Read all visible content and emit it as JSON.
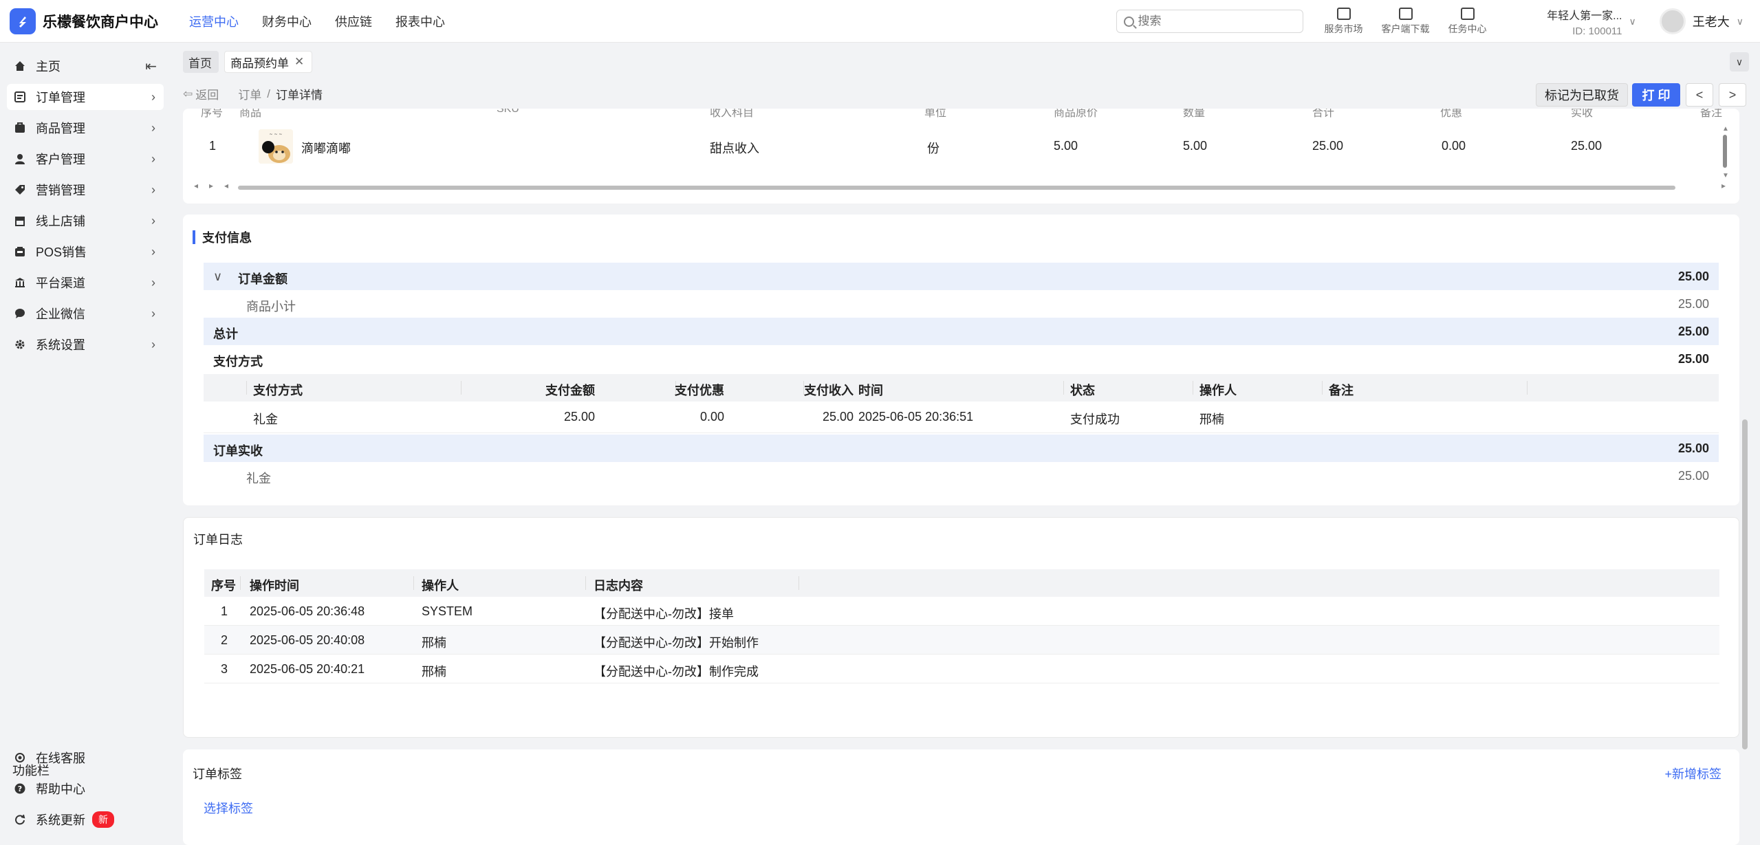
{
  "header": {
    "brand": "乐檬餐饮商户中心",
    "nav": [
      "运营中心",
      "财务中心",
      "供应链",
      "报表中心"
    ],
    "search_placeholder": "搜索",
    "tools": [
      "服务市场",
      "客户端下载",
      "任务中心"
    ],
    "org_name": "年轻人第一家...",
    "org_id": "ID: 100011",
    "user_name": "王老大"
  },
  "sidebar": {
    "items": [
      "主页",
      "订单管理",
      "商品管理",
      "客户管理",
      "营销管理",
      "线上店铺",
      "POS销售",
      "平台渠道",
      "企业微信",
      "系统设置"
    ],
    "func_title": "功能栏",
    "func_items": [
      "在线客服",
      "帮助中心",
      "系统更新"
    ],
    "new_badge": "新"
  },
  "tabs": {
    "home": "首页",
    "current": "商品预约单"
  },
  "breadcrumb": {
    "back": "返回",
    "order": "订单",
    "detail": "订单详情"
  },
  "actions": {
    "mark": "标记为已取货",
    "print": "打 印",
    "prev": "<",
    "next": ">"
  },
  "items": {
    "headers": [
      "序号",
      "商品",
      "SKU",
      "收入科目",
      "单位",
      "商品原价",
      "数量",
      "合计",
      "优惠",
      "实收",
      "备注"
    ],
    "row": {
      "index": "1",
      "name": "滴嘟滴嘟",
      "category": "甜点收入",
      "unit": "份",
      "price": "5.00",
      "qty": "5.00",
      "total": "25.00",
      "discount": "0.00",
      "actual": "25.00"
    }
  },
  "payment": {
    "title": "支付信息",
    "order_amount_label": "订单金额",
    "order_amount": "25.00",
    "subtotal_label": "商品小计",
    "subtotal": "25.00",
    "total_label": "总计",
    "total": "25.00",
    "method_label": "支付方式",
    "method_amount": "25.00",
    "table_headers": [
      "支付方式",
      "支付金额",
      "支付优惠",
      "支付收入",
      "时间",
      "状态",
      "操作人",
      "备注"
    ],
    "table_row": {
      "method": "礼金",
      "amount": "25.00",
      "discount": "0.00",
      "income": "25.00",
      "time": "2025-06-05 20:36:51",
      "status": "支付成功",
      "operator": "邢楠",
      "note": ""
    },
    "actual_label": "订单实收",
    "actual": "25.00",
    "actual_item_label": "礼金",
    "actual_item": "25.00"
  },
  "log": {
    "title": "订单日志",
    "headers": [
      "序号",
      "操作时间",
      "操作人",
      "日志内容"
    ],
    "rows": [
      {
        "idx": "1",
        "time": "2025-06-05 20:36:48",
        "op": "SYSTEM",
        "content": "【分配送中心-勿改】接单"
      },
      {
        "idx": "2",
        "time": "2025-06-05 20:40:08",
        "op": "邢楠",
        "content": "【分配送中心-勿改】开始制作"
      },
      {
        "idx": "3",
        "time": "2025-06-05 20:40:21",
        "op": "邢楠",
        "content": "【分配送中心-勿改】制作完成"
      }
    ]
  },
  "tags": {
    "title": "订单标签",
    "add": "+新增标签",
    "select": "选择标签"
  },
  "colors": {
    "accent": "#3e6cf2",
    "highlight_row": "#eaf0fb",
    "badge": "#f5222d"
  }
}
